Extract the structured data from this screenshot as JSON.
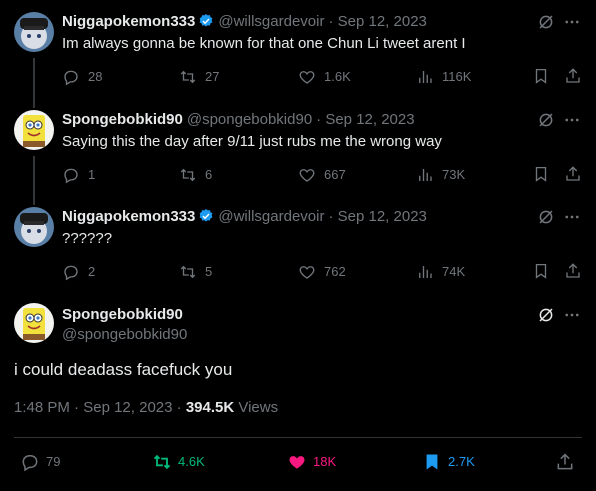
{
  "tweets": [
    {
      "name": "Niggapokemon333",
      "handle": "@willsgardevoir",
      "date": "· Sep 12, 2023",
      "text": "Im always gonna be known for that one Chun Li tweet arent I",
      "replies": "28",
      "reposts": "27",
      "likes": "1.6K",
      "views": "116K"
    },
    {
      "name": "Spongebobkid90",
      "handle": "@spongebobkid90",
      "date": "· Sep 12, 2023",
      "text": "Saying this the day after 9/11 just rubs me the wrong way",
      "replies": "1",
      "reposts": "6",
      "likes": "667",
      "views": "73K"
    },
    {
      "name": "Niggapokemon333",
      "handle": "@willsgardevoir",
      "date": "· Sep 12, 2023",
      "text": "??????",
      "replies": "2",
      "reposts": "5",
      "likes": "762",
      "views": "74K"
    }
  ],
  "main": {
    "name": "Spongebobkid90",
    "handle": "@spongebobkid90",
    "text": "i could deadass facefuck you",
    "time": "1:48 PM",
    "date": "Sep 12, 2023",
    "views_count": "394.5K",
    "views_label": "Views",
    "replies": "79",
    "reposts": "4.6K",
    "likes": "18K",
    "bookmarks": "2.7K"
  },
  "colors": {
    "verified": "#1d9bf0",
    "repost_active": "#00ba7c",
    "like_active": "#f91880",
    "bookmark_active": "#1d9bf0",
    "secondary_text": "#71767b"
  }
}
